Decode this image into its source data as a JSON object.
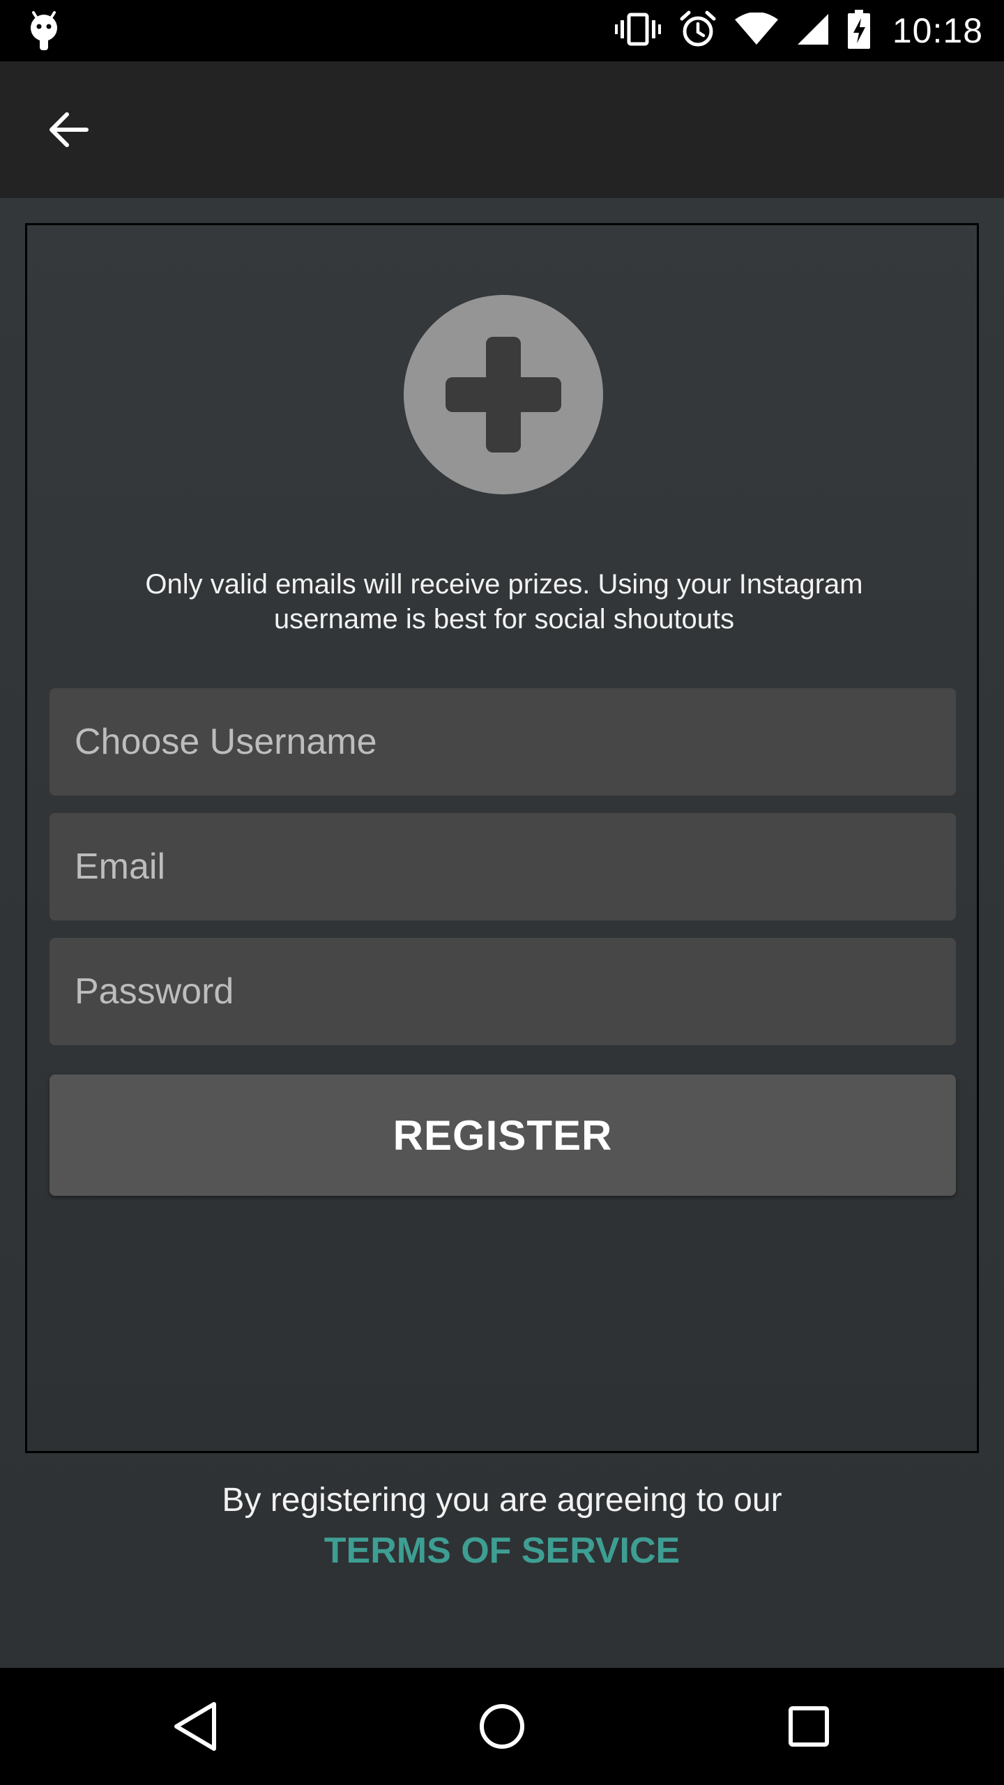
{
  "status_bar": {
    "time": "10:18",
    "icons": [
      "android-debug-icon",
      "vibrate-icon",
      "alarm-icon",
      "wifi-icon",
      "cell-signal-icon",
      "battery-charging-icon"
    ]
  },
  "app_bar": {
    "back_icon": "arrow-back-icon"
  },
  "form": {
    "avatar_icon": "add-photo-icon",
    "hint": "Only valid emails will receive prizes. Using your Instagram username is best for social shoutouts",
    "username_placeholder": "Choose Username",
    "username_value": "",
    "email_placeholder": "Email",
    "email_value": "",
    "password_placeholder": "Password",
    "password_value": "",
    "register_label": "REGISTER"
  },
  "footer": {
    "agree_text": "By registering you are agreeing to our",
    "tos_label": "TERMS OF SERVICE"
  },
  "nav_bar": {
    "icons": [
      "nav-back-icon",
      "nav-home-icon",
      "nav-recents-icon"
    ]
  },
  "colors": {
    "background": "#2f3335",
    "app_bar": "#232323",
    "field": "#474747",
    "button": "#555555",
    "avatar": "#959595",
    "accent": "#3e9e93"
  }
}
